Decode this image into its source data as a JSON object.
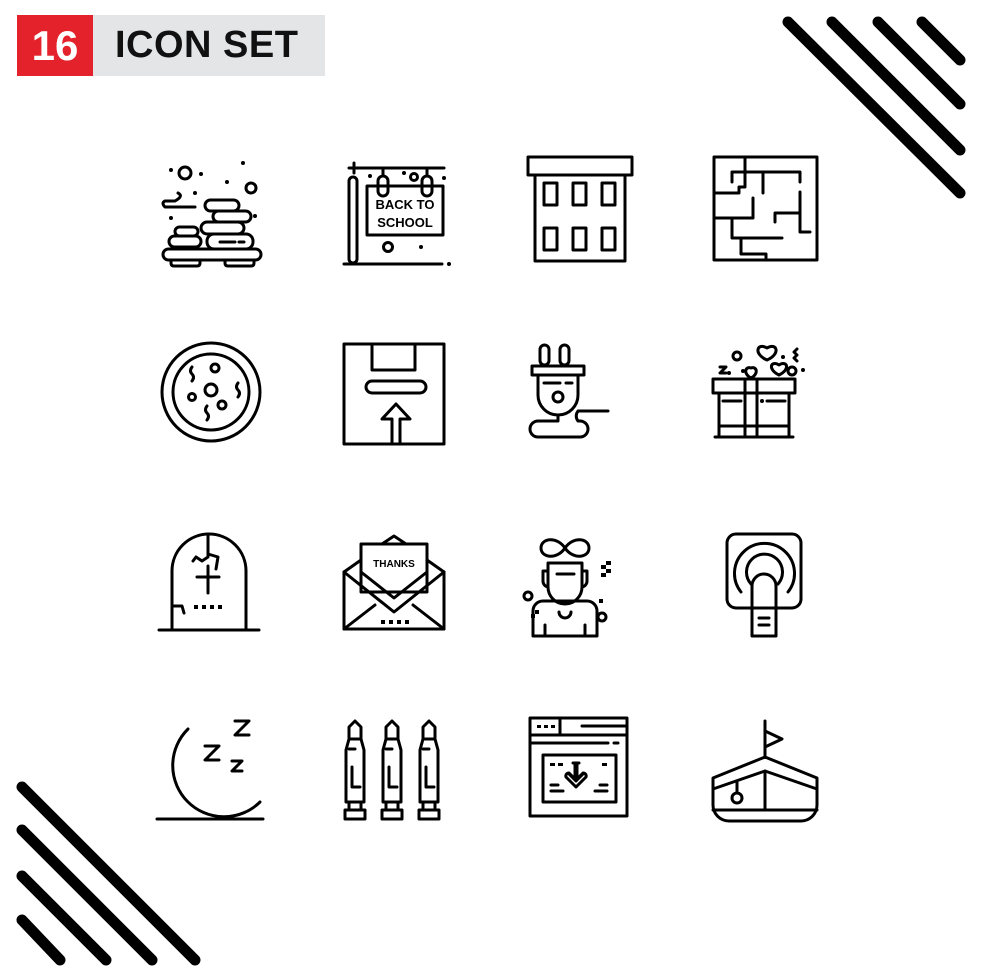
{
  "header": {
    "count": "16",
    "title": "ICON SET",
    "badge_color": "#e3222b",
    "title_bg_color": "#e4e5e7"
  },
  "decorations": [
    "diagonal-stripes-top-right",
    "diagonal-stripes-bottom-left"
  ],
  "icons": [
    {
      "name": "spa-stones-icon",
      "row": 1,
      "col": 1
    },
    {
      "name": "back-to-school-sign-icon",
      "row": 1,
      "col": 2,
      "text_line1": "BACK TO",
      "text_line2": "SCHOOL"
    },
    {
      "name": "building-icon",
      "row": 1,
      "col": 3
    },
    {
      "name": "maze-icon",
      "row": 1,
      "col": 4
    },
    {
      "name": "petri-dish-icon",
      "row": 2,
      "col": 1
    },
    {
      "name": "box-upload-icon",
      "row": 2,
      "col": 2
    },
    {
      "name": "electric-plug-icon",
      "row": 2,
      "col": 3
    },
    {
      "name": "gift-box-hearts-icon",
      "row": 2,
      "col": 4
    },
    {
      "name": "tombstone-icon",
      "row": 3,
      "col": 1
    },
    {
      "name": "thanks-envelope-icon",
      "row": 3,
      "col": 2,
      "text": "THANKS"
    },
    {
      "name": "infinity-mind-person-icon",
      "row": 3,
      "col": 3
    },
    {
      "name": "touch-button-icon",
      "row": 3,
      "col": 4
    },
    {
      "name": "moon-sleep-icon",
      "row": 4,
      "col": 1
    },
    {
      "name": "christmas-lights-icon",
      "row": 4,
      "col": 2
    },
    {
      "name": "browser-download-icon",
      "row": 4,
      "col": 3
    },
    {
      "name": "boat-flag-icon",
      "row": 4,
      "col": 4
    }
  ]
}
